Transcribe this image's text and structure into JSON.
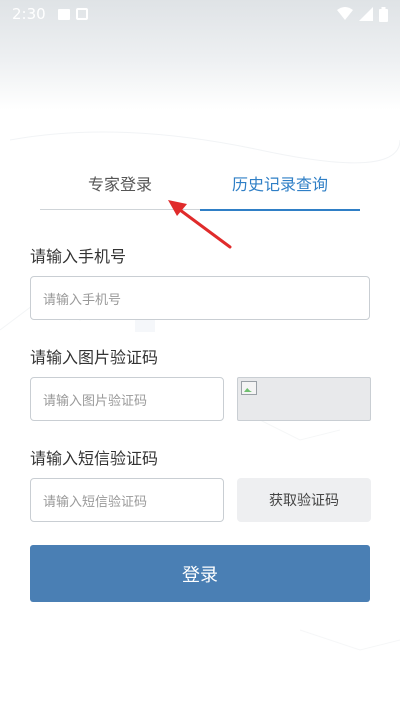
{
  "status_bar": {
    "time": "2:30"
  },
  "tabs": [
    {
      "label": "专家登录",
      "active": false
    },
    {
      "label": "历史记录查询",
      "active": true
    }
  ],
  "form": {
    "phone_label": "请输入手机号",
    "phone_placeholder": "请输入手机号",
    "image_code_label": "请输入图片验证码",
    "image_code_placeholder": "请输入图片验证码",
    "sms_code_label": "请输入短信验证码",
    "sms_code_placeholder": "请输入短信验证码",
    "get_code_label": "获取验证码",
    "login_label": "登录"
  },
  "colors": {
    "accent": "#2f7fc6",
    "login_button": "#4a7fb4",
    "arrow": "#e02b2b"
  }
}
